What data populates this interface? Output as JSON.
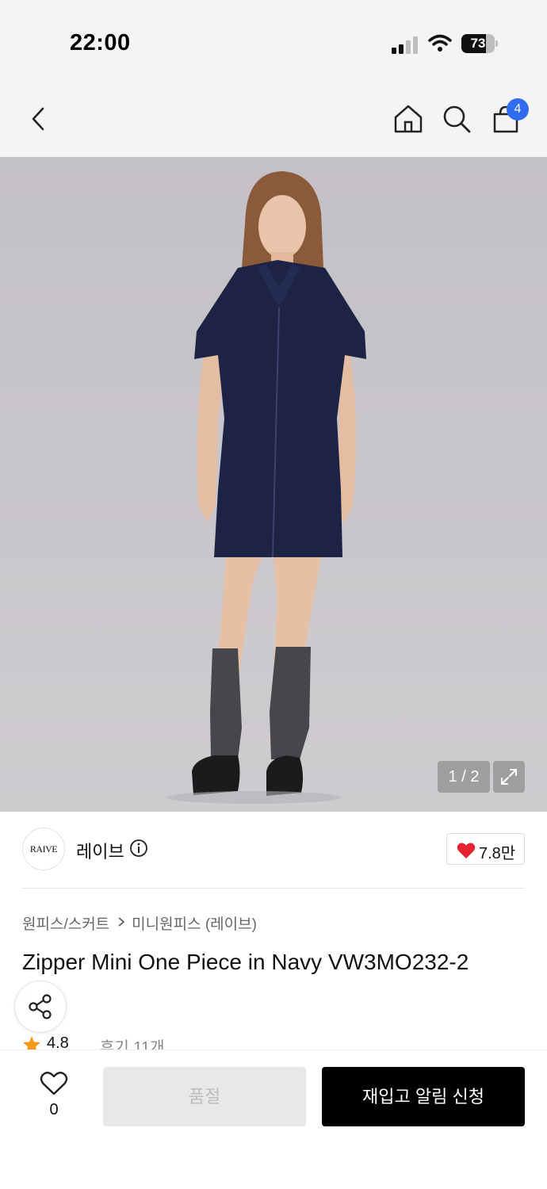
{
  "status_bar": {
    "time": "22:00",
    "battery": "73",
    "battery_level": 0.73
  },
  "header": {
    "back_icon": "chevron-left-icon",
    "home_icon": "home-icon",
    "search_icon": "search-icon",
    "cart_icon": "shopping-bag-icon",
    "cart_count": "4"
  },
  "gallery": {
    "page_indicator": "1 / 2",
    "expand_icon": "expand-icon"
  },
  "brand": {
    "logo_text": "RAIVE",
    "name": "레이브",
    "info_icon": "info-icon",
    "like_icon": "heart-icon",
    "like_count": "7.8만"
  },
  "product": {
    "breadcrumb": [
      "원피스/스커트",
      "미니원피스 (레이브)"
    ],
    "title": "Zipper Mini One Piece in Navy VW3MO232-2",
    "title_overflow": "3",
    "rating": "4.8",
    "review_text": "후기 11개"
  },
  "share": {
    "icon": "share-icon"
  },
  "bottom_bar": {
    "wish_icon": "heart-outline-icon",
    "wish_count": "0",
    "soldout_label": "품절",
    "restock_label": "재입고 알림 신청"
  },
  "colors": {
    "background": "#ffffff",
    "header_bg": "#f4f4f4",
    "badge_blue": "#2f6cf2",
    "heart_red": "#e5232f",
    "star_orange": "#f59a1b",
    "primary_button": "#000000",
    "disabled_button": "#e8e8e8"
  }
}
